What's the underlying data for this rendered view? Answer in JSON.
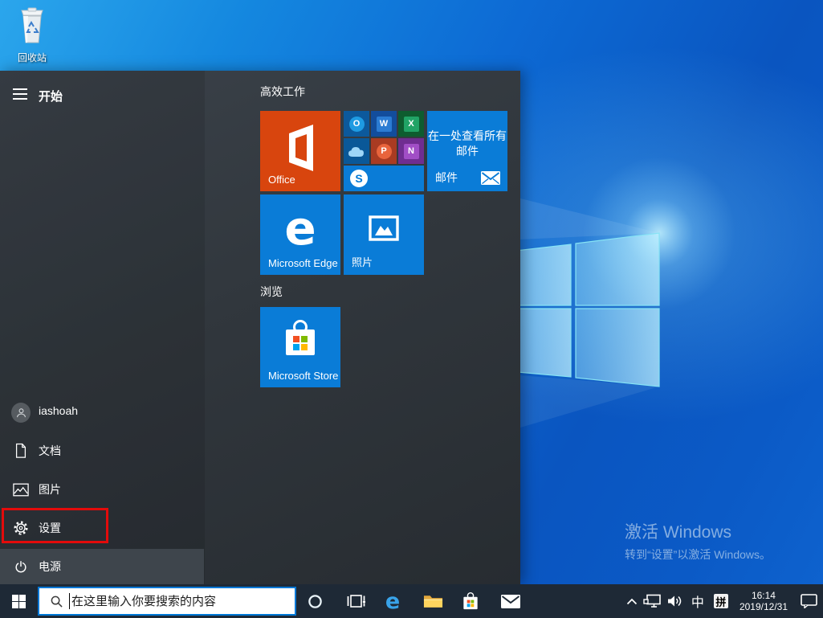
{
  "colors": {
    "accent": "#0078D7",
    "office_tile": "#D8450E",
    "blue_tile": "#0A7CD7",
    "taskbar": "#1E2936",
    "menu_background": "#31373D",
    "annotation_red": "#E30B0B",
    "ms_red": "#F25022",
    "ms_green": "#7FBA00",
    "ms_blue": "#00A4EF",
    "ms_yellow": "#FFB900"
  },
  "icons": {
    "hamburger": "menu-icon",
    "user": "avatar-person",
    "documents": "document-icon",
    "pictures": "picture-icon",
    "settings": "gear-icon",
    "power": "power-icon",
    "search": "magnifier-icon",
    "cortana": "cortana-ring-icon",
    "task_view": "task-view-icon",
    "edge": "edge-e-icon",
    "explorer": "folder-icon",
    "store": "shopping-bag-icon",
    "mail": "envelope-icon",
    "tray_chevron": "chevron-up-icon",
    "network": "ethernet-icon",
    "volume": "speaker-icon",
    "notifications": "action-center-icon",
    "recycle_bin": "recycle-bin-icon"
  },
  "desktop": {
    "recycle_bin_label": "回收站",
    "watermark_line1": "激活 Windows",
    "watermark_line2": "转到“设置”以激活 Windows。"
  },
  "start_menu": {
    "header_label": "开始",
    "section1_label": "高效工作",
    "section2_label": "浏览",
    "tiles": {
      "office_label": "Office",
      "edge_label": "Microsoft Edge",
      "edge_glyph": "e",
      "photos_label": "照片",
      "store_label": "Microsoft Store",
      "mail_caption_line1": "在一处查看所有",
      "mail_caption_line2": "邮件",
      "mail_label": "邮件",
      "app_glyphs": {
        "outlook": "O",
        "word": "W",
        "excel": "X",
        "powerpoint": "P",
        "onenote": "N",
        "skype": "S"
      }
    },
    "nav": [
      {
        "label": "iashoah"
      },
      {
        "label": "文档"
      },
      {
        "label": "图片"
      },
      {
        "label": "设置"
      },
      {
        "label": "电源"
      }
    ]
  },
  "taskbar": {
    "search_placeholder": "在这里输入你要搜索的内容",
    "tray": {
      "ime_language": "中",
      "ime_mode": "拼",
      "time": "16:14",
      "date": "2019/12/31"
    }
  }
}
